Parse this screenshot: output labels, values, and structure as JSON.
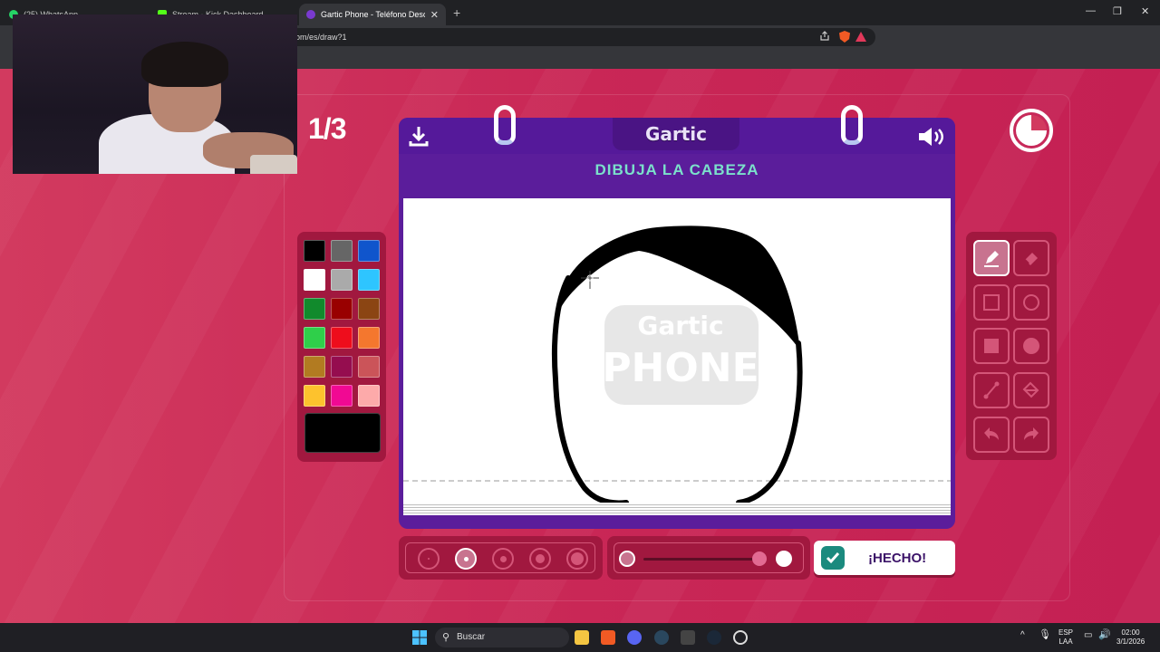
{
  "browser": {
    "tabs": [
      {
        "title": "(25) WhatsApp",
        "active": false
      },
      {
        "title": "Stream - Kick Dashboard",
        "active": false
      },
      {
        "title": "Gartic Phone - Teléfono Descom",
        "active": true
      }
    ],
    "new_tab": "+",
    "url": "om/es/draw?1",
    "window_controls": {
      "minimize": "—",
      "maximize": "❐",
      "close": "✕"
    }
  },
  "game": {
    "round": "1/3",
    "logo": "Gartic",
    "prompt": "DIBUJA LA CABEZA",
    "watermark": [
      "Gartic",
      "PHONE"
    ],
    "done_label": "¡HECHO!",
    "selected_color": "#000000",
    "palette": [
      "#000000",
      "#666666",
      "#1055cc",
      "#ffffff",
      "#aaaaaa",
      "#2ec5ff",
      "#118a2c",
      "#990000",
      "#8b4513",
      "#2fcf4a",
      "#ee0d1c",
      "#f4772e",
      "#b27b21",
      "#950d4f",
      "#cb5459",
      "#fdc22d",
      "#f10993",
      "#fdaaaa"
    ],
    "brush_sizes": 5,
    "selected_brush_index": 1,
    "tools": [
      "pencil-icon",
      "eraser-icon",
      "rect-outline-icon",
      "circle-outline-icon",
      "rect-filled-icon",
      "circle-filled-icon",
      "line-icon",
      "bucket-icon",
      "undo-icon",
      "redo-icon"
    ],
    "selected_tool": "pencil-icon"
  },
  "taskbar": {
    "search_placeholder": "Buscar",
    "lang": [
      "ESP",
      "LAA"
    ],
    "time": "02:00",
    "date": "3/1/2026"
  },
  "colors": {
    "accent_purple": "#5b1d9b",
    "page_red": "#c92756",
    "teal": "#7be0cb"
  }
}
